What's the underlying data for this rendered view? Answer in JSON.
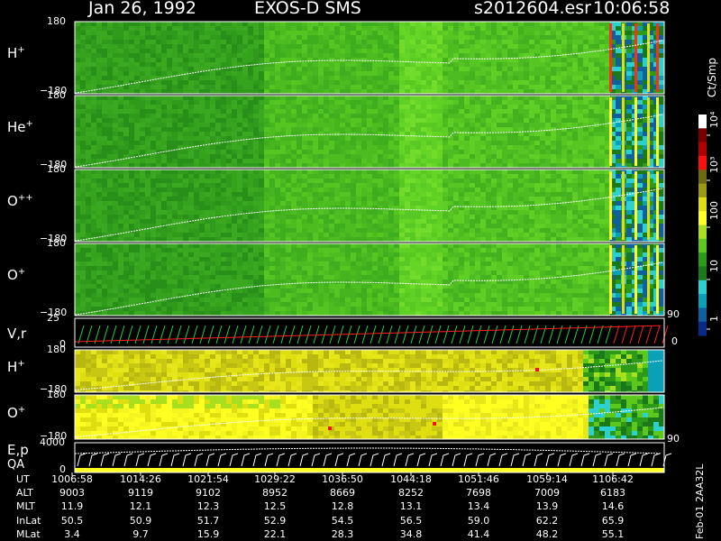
{
  "header": {
    "date": "Jan 26, 1992",
    "instrument": "EXOS-D SMS",
    "file": "s2012604.esr",
    "time": "10:06:58"
  },
  "colorbar": {
    "unit": "Ct/Smp",
    "ticks": [
      "10⁴",
      "10³",
      "100",
      "10",
      "1"
    ],
    "colors": [
      "#ffffff",
      "#7a0000",
      "#b00000",
      "#ff1010",
      "#6e6a10",
      "#9b9a10",
      "#dede10",
      "#ffff22",
      "#a8e020",
      "#5cc81c",
      "#2e9a1a",
      "#1a7a1a",
      "#2bd0d0",
      "#0aa0b8",
      "#1060a0",
      "#0a2a8a"
    ]
  },
  "chart_data": {
    "type": "heatmap",
    "panels": [
      {
        "label": "H",
        "charge": "+",
        "ymax": "180",
        "ymin": "−180"
      },
      {
        "label": "He",
        "charge": "+",
        "ymax": "180",
        "ymin": "−180"
      },
      {
        "label": "O",
        "charge": "++",
        "ymax": "180",
        "ymin": "−180"
      },
      {
        "label": "O",
        "charge": "+",
        "ymax": "180",
        "ymin": "−180"
      },
      {
        "label": "V,r",
        "charge": "",
        "ymax": "25",
        "ymin": "0"
      },
      {
        "label": "H",
        "charge": "+",
        "ymax": "180",
        "ymin": "−180"
      },
      {
        "label": "O",
        "charge": "+",
        "ymax": "180",
        "ymin": "−180"
      },
      {
        "label": "E,p",
        "sublabel": "QA",
        "ymax": "4000",
        "ymin": "0"
      }
    ],
    "right_axis": [
      "90",
      "0",
      "90"
    ],
    "side_note": "Feb-01 2AA32L",
    "ephemeris": {
      "row_labels": [
        "UT",
        "ALT",
        "MLT",
        "InLat",
        "MLat"
      ],
      "columns": [
        [
          "1006:58",
          "9003",
          "11.9",
          "50.5",
          "3.4"
        ],
        [
          "1014:26",
          "9119",
          "12.1",
          "50.9",
          "9.7"
        ],
        [
          "1021:54",
          "9102",
          "12.3",
          "51.7",
          "15.9"
        ],
        [
          "1029:22",
          "8952",
          "12.5",
          "52.9",
          "22.1"
        ],
        [
          "1036:50",
          "8669",
          "12.8",
          "54.5",
          "28.3"
        ],
        [
          "1044:18",
          "8252",
          "13.1",
          "56.5",
          "34.8"
        ],
        [
          "1051:46",
          "7698",
          "13.4",
          "59.0",
          "41.4"
        ],
        [
          "1059:14",
          "7009",
          "13.9",
          "62.2",
          "48.2"
        ],
        [
          "1106:42",
          "6183",
          "14.6",
          "65.9",
          "55.1"
        ]
      ]
    }
  }
}
